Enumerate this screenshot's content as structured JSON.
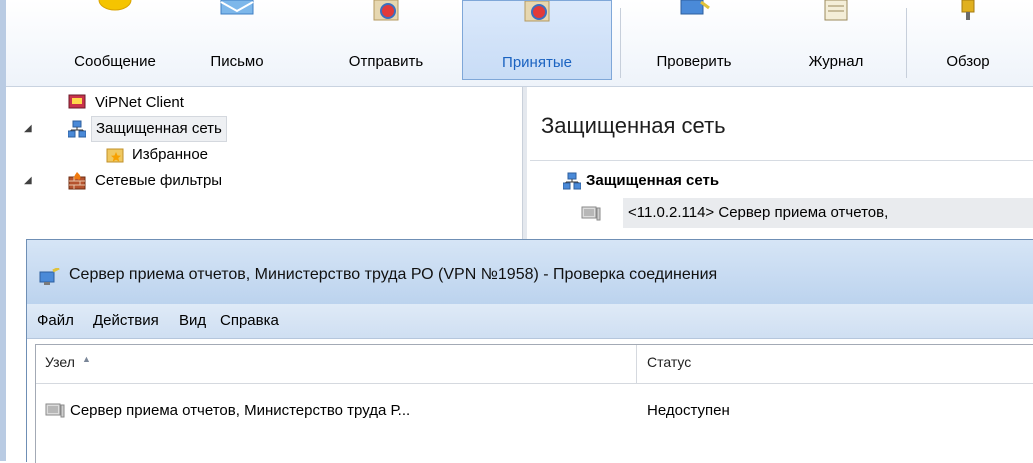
{
  "toolbar": {
    "buttons": [
      {
        "label": "Сообщение"
      },
      {
        "label": "Письмо"
      },
      {
        "label": "Отправить"
      },
      {
        "label": "Принятые"
      },
      {
        "label": "Проверить"
      },
      {
        "label": "Журнал"
      },
      {
        "label": "Обзор"
      }
    ],
    "active_color": "#1b63c1"
  },
  "tree": {
    "items": [
      {
        "label": "ViPNet Client",
        "icon": "vipnet-client-icon"
      },
      {
        "label": "Защищенная сеть",
        "icon": "network-icon",
        "expanded": true,
        "selected": true
      },
      {
        "label": "Избранное",
        "icon": "favorites-folder-icon"
      },
      {
        "label": "Сетевые фильтры",
        "icon": "firewall-icon",
        "expanded": true
      }
    ]
  },
  "right_pane": {
    "title": "Защищенная сеть",
    "group": "Защищенная сеть",
    "row": "<11.0.2.114> Сервер приема отчетов,"
  },
  "dialog": {
    "title": "Сервер приема отчетов, Министерство труда РО (VPN №1958) - Проверка соединения",
    "menu": [
      "Файл",
      "Действия",
      "Вид",
      "Справка"
    ],
    "columns": [
      "Узел",
      "Статус"
    ],
    "rows": [
      {
        "node": "Сервер приема отчетов, Министерство труда Р...",
        "status": "Недоступен"
      }
    ]
  }
}
